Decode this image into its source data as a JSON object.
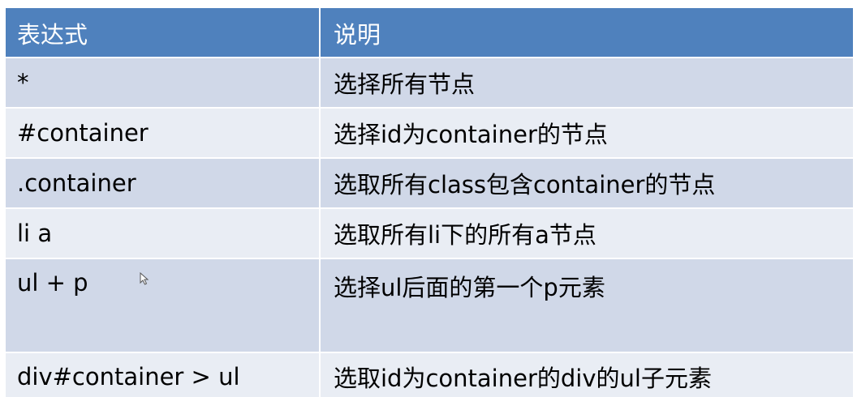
{
  "table": {
    "headers": [
      "表达式",
      "说明"
    ],
    "rows": [
      {
        "expr": "*",
        "desc": "选择所有节点"
      },
      {
        "expr": "#container",
        "desc": "选择id为container的节点"
      },
      {
        "expr": ".container",
        "desc": "选取所有class包含container的节点"
      },
      {
        "expr": "li a",
        "desc": "选取所有li下的所有a节点"
      },
      {
        "expr": "ul + p",
        "desc": "选择ul后面的第一个p元素"
      },
      {
        "expr": "div#container > ul",
        "desc": "选取id为container的div的ul子元素"
      }
    ]
  },
  "colors": {
    "header_bg": "#4f81bd",
    "row_odd_bg": "#d0d8e8",
    "row_even_bg": "#e9edf4"
  },
  "icons": {
    "cursor": "mouse-pointer-icon"
  }
}
